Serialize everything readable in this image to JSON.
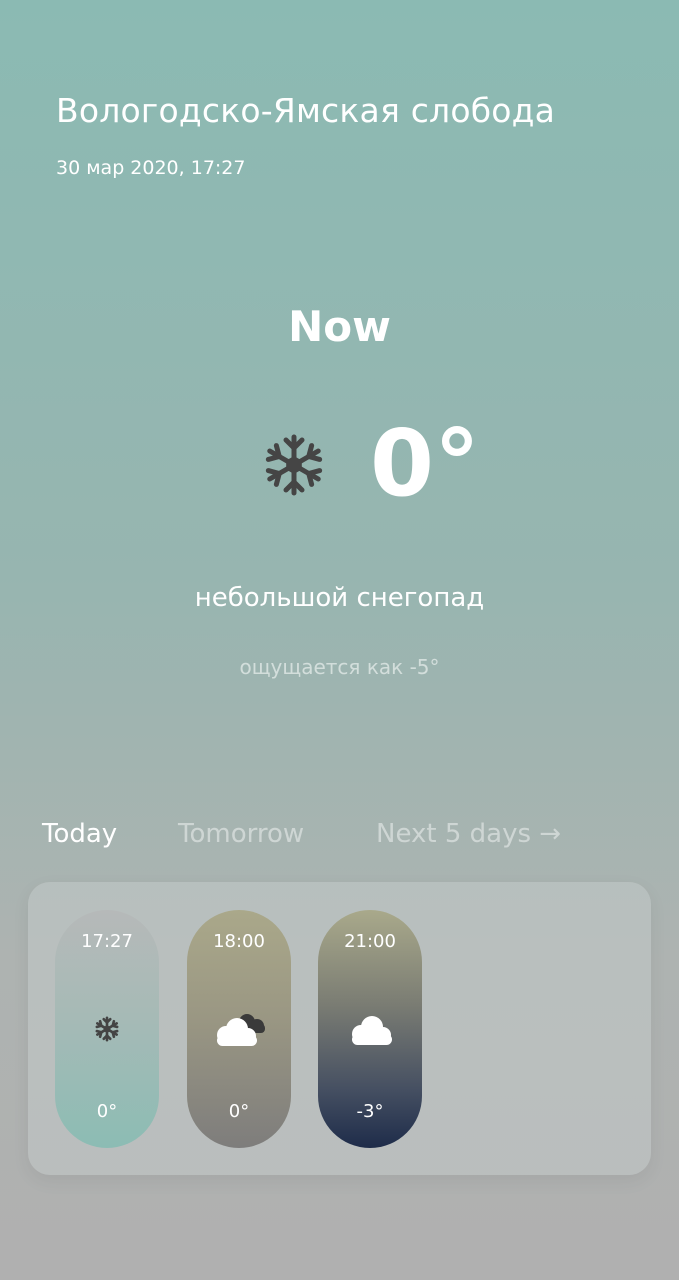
{
  "header": {
    "city": "Вологодско-Ямская слобода",
    "datetime": "30 мар 2020, 17:27"
  },
  "current": {
    "label": "Now",
    "icon": "snowflake-icon",
    "temperature": "0°",
    "condition": "небольшой снегопад",
    "feels_like": "ощущается как -5°"
  },
  "tabs": [
    {
      "label": "Today",
      "active": true
    },
    {
      "label": "Tomorrow",
      "active": false
    },
    {
      "label": "Next 5 days →",
      "active": false
    }
  ],
  "hourly": [
    {
      "time": "17:27",
      "icon": "snowflake-icon",
      "temp": "0°"
    },
    {
      "time": "18:00",
      "icon": "cloudy-icon",
      "temp": "0°"
    },
    {
      "time": "21:00",
      "icon": "cloud-icon",
      "temp": "-3°"
    }
  ],
  "colors": {
    "text": "#ffffff",
    "icon_dark": "#444444",
    "background_top": "#8bbab3",
    "background_bottom": "#b0b0b0"
  }
}
